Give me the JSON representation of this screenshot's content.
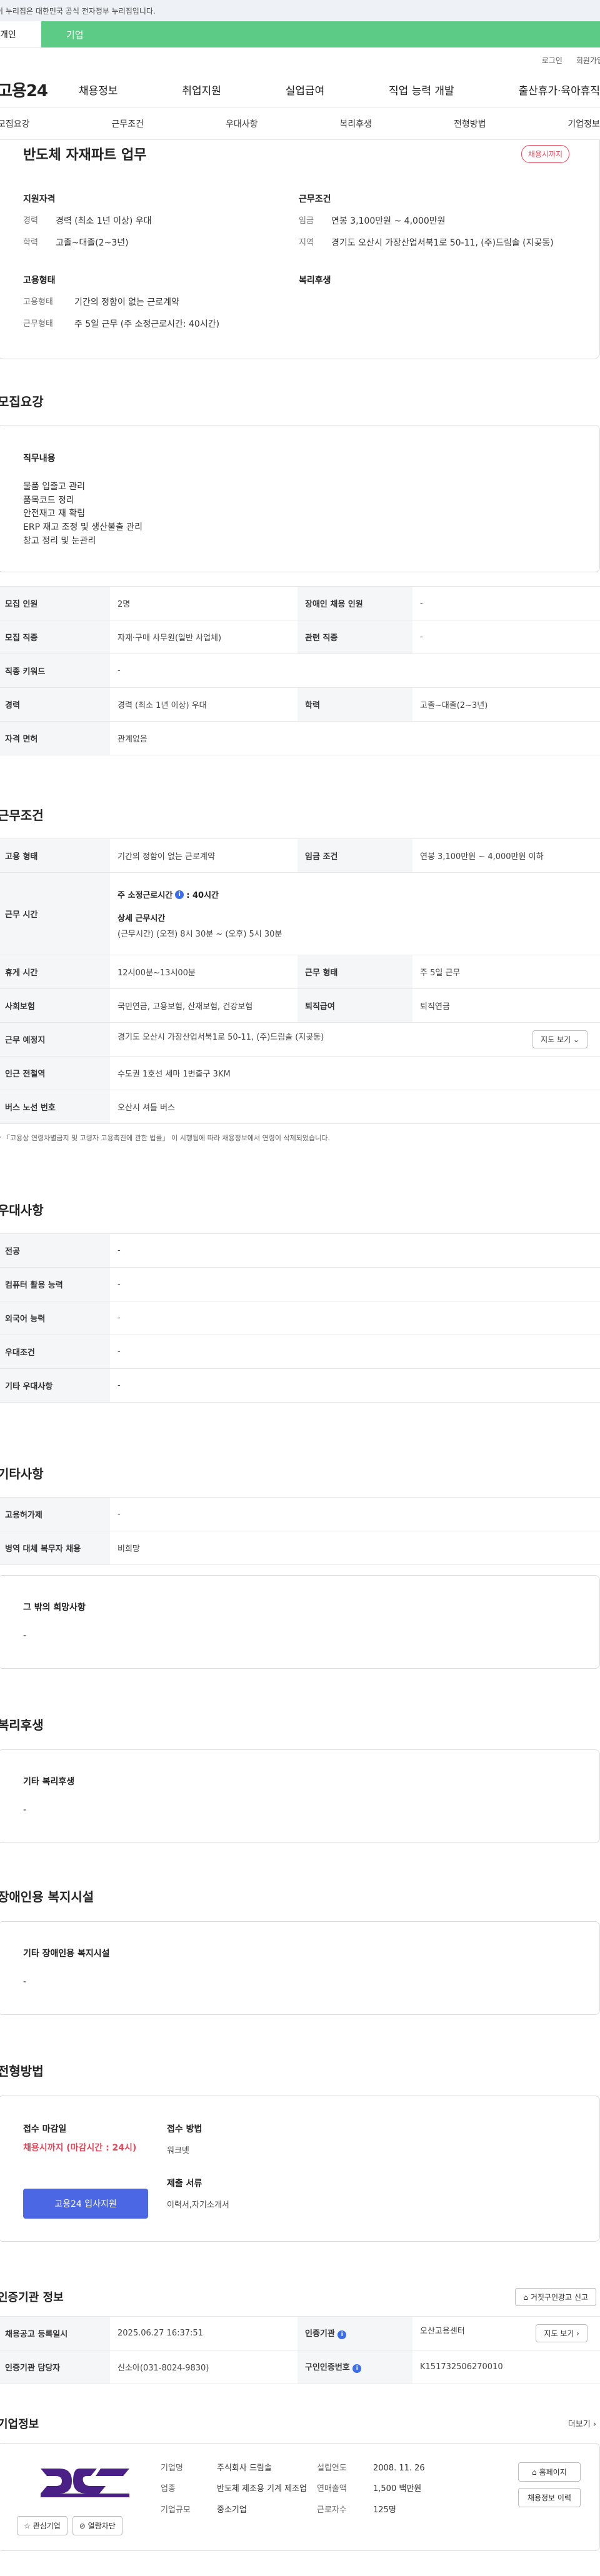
{
  "banner": {
    "text": "이 누리집은 대한민국 공식 전자정부 누리집입니다."
  },
  "site_tabs": {
    "personal": "개인",
    "company": "기업"
  },
  "util": {
    "login": "로그인",
    "join": "회원가입"
  },
  "gnb": {
    "logo": "고용24",
    "menu": [
      "채용정보",
      "취업지원",
      "실업급여",
      "직업 능력 개발",
      "출산휴가·육아휴직"
    ]
  },
  "anchor_nav": [
    "모집요강",
    "근무조건",
    "우대사항",
    "복리후생",
    "전형방법",
    "기업정보"
  ],
  "summary": {
    "title": "반도체 자재파트 업무",
    "badge": "채용시까지",
    "qual_heading": "지원자격",
    "cond_heading": "근무조건",
    "employ_heading": "고용형태",
    "welfare_heading": "복리후생",
    "career_k": "경력",
    "career_v": "경력 (최소 1년 이상) 우대",
    "edu_k": "학력",
    "edu_v": "고졸~대졸(2~3년)",
    "wage_k": "임금",
    "wage_v": "연봉 3,100만원 ~ 4,000만원",
    "area_k": "지역",
    "area_v": "경기도 오산시 가장산업서북1로 50-11, (주)드림솔 (지곶동)",
    "type_k": "고용형태",
    "type_v": "기간의 정함이 없는 근로계약",
    "form_k": "근무형태",
    "form_v": "주 5일 근무 (주 소정근로시간: 40시간)"
  },
  "recruit": {
    "title": "모집요강",
    "duty_heading": "직무내용",
    "duties": [
      "물품 입출고 관리",
      "품목코드 정리",
      "안전재고 재 확립",
      "ERP 재고 조정 및 생산불출 관리",
      "창고 정리 및 눈관리"
    ],
    "table": {
      "people_k": "모집 인원",
      "people_v": "2명",
      "disabled_k": "장애인 채용 인원",
      "disabled_v": "-",
      "job_k": "모집 직종",
      "job_v": "자재·구매 사무원(일반 사업체)",
      "related_k": "관련 직종",
      "related_v": "-",
      "keyword_k": "직종 키워드",
      "keyword_v": "-",
      "career_k": "경력",
      "career_v": "경력 (최소 1년 이상) 우대",
      "edu_k": "학력",
      "edu_v": "고졸~대졸(2~3년)",
      "license_k": "자격 면허",
      "license_v": "관계없음"
    }
  },
  "work": {
    "title": "근무조건",
    "type_k": "고용 형태",
    "type_v": "기간의 정함이 없는 근로계약",
    "wage_k": "임금 조건",
    "wage_v": "연봉 3,100만원 ~ 4,000만원 이하",
    "hours_k": "근무 시간",
    "hours_main": "주 소정근로시간",
    "hours_main_v": ": 40시간",
    "hours_detail_title": "상세 근무시간",
    "hours_detail": "(근무시간) (오전) 8시 30분 ~ (오후) 5시 30분",
    "rest_k": "휴게 시간",
    "rest_v": "12시00분~13시00분",
    "form_k": "근무 형태",
    "form_v": "주 5일 근무",
    "insurance_k": "사회보험",
    "insurance_v": "국민연금, 고용보험, 산재보험, 건강보험",
    "severance_k": "퇴직급여",
    "severance_v": "퇴직연금",
    "place_k": "근무 예정지",
    "place_v": "경기도 오산시 가장산업서북1로 50-11, (주)드림솔 (지곶동)",
    "map_button": "지도 보기 ⌄",
    "subway_k": "인근 전철역",
    "subway_v": "수도권 1호선 세마 1번출구 3KM",
    "bus_k": "버스 노선 번호",
    "bus_v": "오산시 셔틀 버스",
    "note": "* 「고용상 연령차별금지 및 고령자 고용촉진에 관한 법률」 이 시행됨에 따라 채용정보에서 연령이 삭제되었습니다."
  },
  "pref": {
    "title": "우대사항",
    "rows": [
      {
        "k": "전공",
        "v": "-"
      },
      {
        "k": "컴퓨터 활용 능력",
        "v": "-"
      },
      {
        "k": "외국어 능력",
        "v": "-"
      },
      {
        "k": "우대조건",
        "v": "-"
      },
      {
        "k": "기타 우대사항",
        "v": "-"
      }
    ]
  },
  "etc": {
    "title": "기타사항",
    "rows": [
      {
        "k": "고용허가제",
        "v": "-"
      },
      {
        "k": "병역 대체 복무자 채용",
        "v": "비희망"
      }
    ],
    "box_title": "그 밖의 희망사항",
    "box_value": "-"
  },
  "welfare": {
    "title": "복리후생",
    "box_title": "기타 복리후생",
    "box_value": "-"
  },
  "disab": {
    "title": "장애인용 복지시설",
    "box_title": "기타 장애인용 복지시설",
    "box_value": "-"
  },
  "apply": {
    "title": "전형방법",
    "deadline_label": "접수 마감일",
    "deadline_value": "채용시까지 (마감시간 : 24시)",
    "button": "고용24 입사지원",
    "method_label": "접수 방법",
    "method_value": "워크넷",
    "docs_label": "제출 서류",
    "docs_value": "이력서,자기소개서"
  },
  "cert": {
    "title": "인증기관 정보",
    "report_button": "⌂ 거짓구인광고 신고",
    "reg_k": "채용공고 등록일시",
    "reg_v": "2025.06.27 16:37:51",
    "org_k": "인증기관",
    "org_v": "오산고용센터",
    "map_button": "지도 보기 ›",
    "manager_k": "인증기관 담당자",
    "manager_v": "신소아(031-8024-9830)",
    "cert_no_k": "구인인증번호",
    "cert_no_v": "K151732506270010"
  },
  "company": {
    "title": "기업정보",
    "more": "더보기 ›",
    "logo_text": "(주)드림솔",
    "fav_button": "☆ 관심기업",
    "block_button": "⊘ 열람차단",
    "name_k": "기업명",
    "name_v": "주식회사 드림솔",
    "biz_k": "업종",
    "biz_v": "반도체 제조용 기계 제조업",
    "scale_k": "기업규모",
    "scale_v": "중소기업",
    "year_k": "설립연도",
    "year_v": "2008. 11. 26",
    "sales_k": "연매출액",
    "sales_v": "1,500 백만원",
    "staff_k": "근로자수",
    "staff_v": "125명",
    "homepage_button": "⌂ 홈페이지",
    "history_button": "채용정보 이력"
  },
  "colors": {
    "brand_green": "#5ccb85",
    "badge_red": "#e2475a",
    "apply_blue": "#4b67e3",
    "logo_purple": "#4a1f86"
  }
}
